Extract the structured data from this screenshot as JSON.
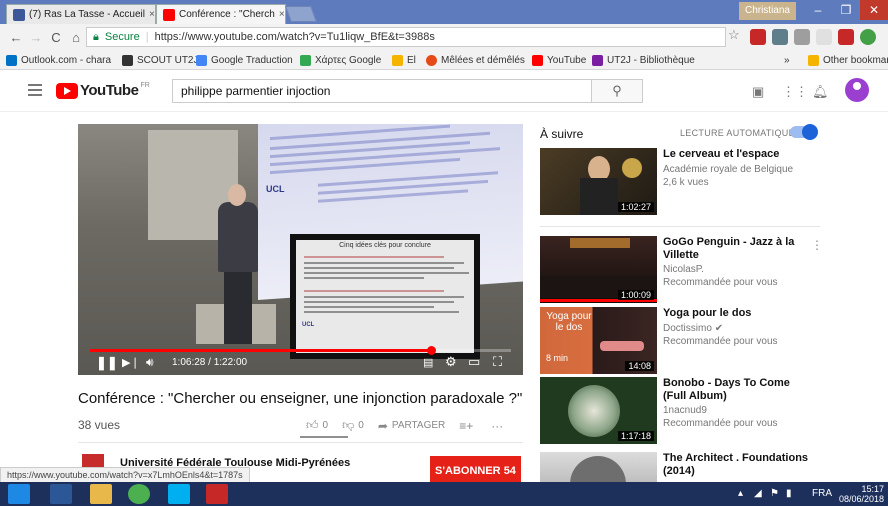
{
  "browser": {
    "tabs": [
      {
        "label": "(7) Ras La Tasse - Accueil",
        "icon": "facebook-icon",
        "color": "#3b5998"
      },
      {
        "label": "Conférence : \"Cherch",
        "icon": "youtube-icon",
        "color": "#ff0000"
      }
    ],
    "user": "Christiana",
    "address": {
      "secure_label": "Secure",
      "url": "https://www.youtube.com/watch?v=Tu1liqw_BfE&t=3988s"
    },
    "bookmarks": [
      {
        "label": "Outlook.com - chara",
        "color": "#0072c6"
      },
      {
        "label": "SCOUT UT2J",
        "color": "#333333"
      },
      {
        "label": "Google Traduction",
        "color": "#4285f4"
      },
      {
        "label": "Χάρτες Google",
        "color": "#34a853"
      },
      {
        "label": "El",
        "color": "#f4b400"
      },
      {
        "label": "Mêlées et démêlés",
        "color": "#e64a19"
      },
      {
        "label": "YouTube",
        "color": "#ff0000"
      },
      {
        "label": "UT2J - Bibliothèque",
        "color": "#7b1fa2"
      }
    ],
    "more_bookmarks": "»",
    "other_bookmarks": "Other bookmarks"
  },
  "youtube": {
    "logo_text": "YouTube",
    "logo_region": "FR",
    "search_query": "philippe parmentier injoction",
    "video": {
      "current_time": "1:06:28",
      "duration": "1:22:00",
      "progress": 0.81,
      "slide_title": "Cinq idées clés pour conclure",
      "slide_logo": "UCL",
      "projection_logo": "UCL",
      "title": "Conférence : \"Chercher ou enseigner, une injonction paradoxale ?\"",
      "views": "38 vues",
      "likes": "0",
      "dislikes": "0",
      "share_label": "PARTAGER"
    },
    "channel": {
      "name": "Université Fédérale Toulouse Midi-Pyrénées",
      "subscribe_label": "S'ABONNER",
      "subscriber_count": "54"
    },
    "status_url": "https://www.youtube.com/watch?v=x7LmhOEnls4&t=1787s",
    "sidebar": {
      "up_next": "À suivre",
      "autoplay_label": "LECTURE AUTOMATIQUE",
      "autoplay_on": true,
      "items": [
        {
          "title": "Le cerveau et l'espace",
          "channel": "Académie royale de Belgique",
          "meta": "2,6 k vues",
          "duration": "1:02:27",
          "thumb_color": "#5a4a2c"
        },
        {
          "title": "GoGo Penguin - Jazz à la Villette",
          "channel": "NicolasP.",
          "meta": "Recommandée pour vous",
          "duration": "1:00:09",
          "thumb_color": "#2b1b16"
        },
        {
          "title": "Yoga pour le dos",
          "channel": "Doctissimo",
          "meta": "Recommandée pour vous",
          "duration": "14:08",
          "thumb_color": "#c8623a",
          "thumb_text": "Yoga pour le dos",
          "thumb_sub": "8 min"
        },
        {
          "title": "Bonobo - Days To Come (Full Album)",
          "channel": "1nacnud9",
          "meta": "Recommandée pour vous",
          "duration": "1:17:18",
          "thumb_color": "#2c4a2a"
        },
        {
          "title": "The Architect . Foundations (2014)",
          "channel": "",
          "meta": "",
          "duration": "",
          "thumb_color": "#7f7f7f"
        }
      ]
    }
  },
  "taskbar": {
    "lang": "FRA",
    "time": "15:17",
    "date": "08/06/2018"
  }
}
